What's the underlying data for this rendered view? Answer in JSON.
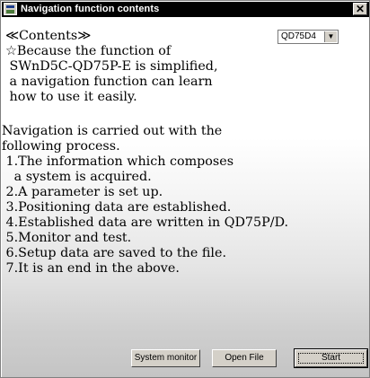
{
  "window": {
    "title": "Navigation function contents",
    "close_label": "✕"
  },
  "model_select": {
    "value": "QD75D4",
    "arrow": "▼"
  },
  "intro": [
    "≪Contents≫",
    "☆Because the function of",
    " SWnD5C-QD75P-E is simplified,",
    " a navigation function can learn",
    " how to use it easily."
  ],
  "process": [
    "Navigation is carried out with the",
    "following process.",
    " 1.The information which composes",
    "   a system is acquired.",
    " 2.A parameter is set up.",
    " 3.Positioning data are established.",
    " 4.Established data are written in QD75P/D.",
    " 5.Monitor and test.",
    " 6.Setup data are saved to the file.",
    " 7.It is an end in the above."
  ],
  "buttons": {
    "system_monitor": "System monitor",
    "open_file": "Open File",
    "start": "Start"
  }
}
